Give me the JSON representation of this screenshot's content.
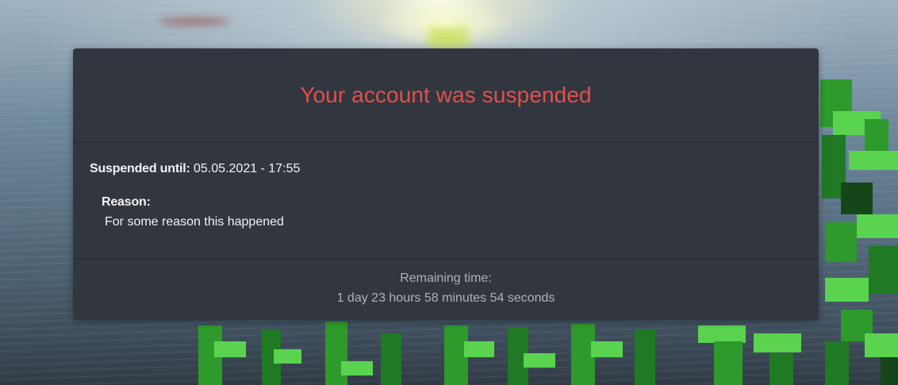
{
  "modal": {
    "title": "Your account was suspended",
    "suspended_until_label": "Suspended until:",
    "suspended_until_value": "05.05.2021 - 17:55",
    "reason_label": "Reason:",
    "reason_text": "For some reason this happened",
    "remaining_label": "Remaining time:",
    "remaining_value": "1 day 23 hours 58 minutes 54 seconds"
  },
  "colors": {
    "card_background": "#32363e",
    "title_red": "#e0504d",
    "body_text": "#f2f2f2",
    "footer_text": "#aeb2b8"
  }
}
